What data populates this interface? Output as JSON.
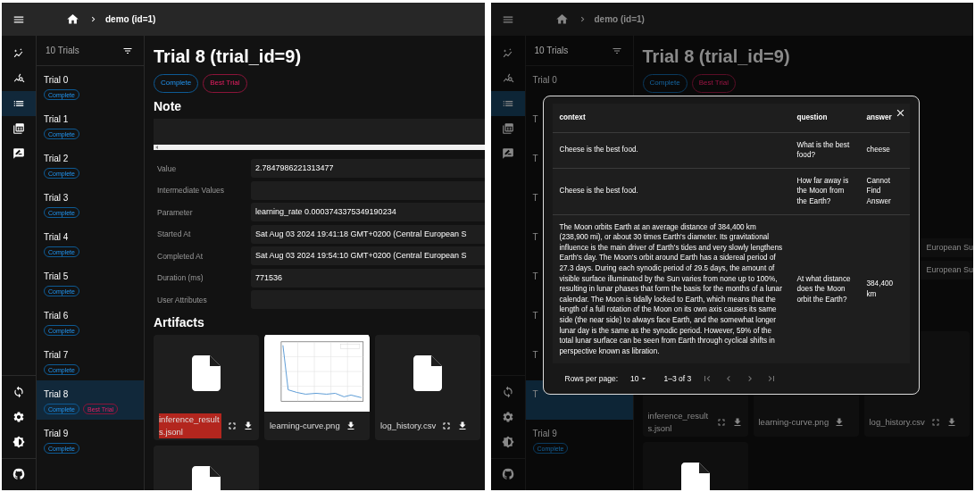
{
  "panels": [
    {
      "header": {
        "breadcrumb": "demo (id=1)"
      },
      "rail": [
        {
          "kind": "sparkle-chart",
          "selected": false
        },
        {
          "kind": "search-chart",
          "selected": false
        },
        {
          "kind": "list",
          "selected": true
        },
        {
          "kind": "table",
          "selected": false
        },
        {
          "kind": "feedback",
          "selected": false
        },
        {
          "kind": "sync",
          "selected": false
        },
        {
          "kind": "settings",
          "selected": false
        },
        {
          "kind": "theme",
          "selected": false
        },
        {
          "kind": "repo",
          "selected": false
        }
      ],
      "trial_list": {
        "count": "10 Trials",
        "trials": [
          {
            "name": "Trial 0",
            "selected": false,
            "badges": [
              {
                "label": "Complete",
                "kind": "complete"
              }
            ]
          },
          {
            "name": "Trial 1",
            "selected": false,
            "badges": [
              {
                "label": "Complete",
                "kind": "complete"
              }
            ]
          },
          {
            "name": "Trial 2",
            "selected": false,
            "badges": [
              {
                "label": "Complete",
                "kind": "complete"
              }
            ]
          },
          {
            "name": "Trial 3",
            "selected": false,
            "badges": [
              {
                "label": "Complete",
                "kind": "complete"
              }
            ]
          },
          {
            "name": "Trial 4",
            "selected": false,
            "badges": [
              {
                "label": "Complete",
                "kind": "complete"
              }
            ]
          },
          {
            "name": "Trial 5",
            "selected": false,
            "badges": [
              {
                "label": "Complete",
                "kind": "complete"
              }
            ]
          },
          {
            "name": "Trial 6",
            "selected": false,
            "badges": [
              {
                "label": "Complete",
                "kind": "complete"
              }
            ]
          },
          {
            "name": "Trial 7",
            "selected": false,
            "badges": [
              {
                "label": "Complete",
                "kind": "complete"
              }
            ]
          },
          {
            "name": "Trial 8",
            "selected": true,
            "badges": [
              {
                "label": "Complete",
                "kind": "complete"
              },
              {
                "label": "Best Trial",
                "kind": "best"
              }
            ]
          },
          {
            "name": "Trial 9",
            "selected": false,
            "badges": [
              {
                "label": "Complete",
                "kind": "complete"
              }
            ]
          }
        ]
      },
      "detail": {
        "title": "Trial 8 (trial_id=9)",
        "badges": [
          {
            "label": "Complete",
            "kind": "complete"
          },
          {
            "label": "Best Trial",
            "kind": "best"
          }
        ],
        "note_heading": "Note",
        "fields": [
          {
            "label": "Value",
            "value": "2.7847986221313477"
          },
          {
            "label": "Intermediate Values"
          },
          {
            "label": "Parameter",
            "value": "learning_rate 0.0003743375349190234"
          },
          {
            "label": "Started At",
            "value": "Sat Aug 03 2024 19:41:18 GMT+0200 (Central European S"
          },
          {
            "label": "Completed At",
            "value": "Sat Aug 03 2024 19:54:10 GMT+0200 (Central European S"
          },
          {
            "label": "Duration (ms)",
            "value": "771536"
          },
          {
            "label": "User Attributes"
          }
        ],
        "artifacts_heading": "Artifacts",
        "artifacts": [
          {
            "kind": "file",
            "name": "inference_results.jsonl",
            "highlighted": true,
            "fullscreen": true
          },
          {
            "kind": "image",
            "name": "learning-curve.png",
            "highlighted": false,
            "fullscreen": false
          },
          {
            "kind": "file",
            "name": "log_history.csv",
            "highlighted": false,
            "fullscreen": true
          },
          {
            "kind": "file"
          }
        ]
      }
    },
    {
      "header": {
        "breadcrumb": "demo (id=1)"
      },
      "rail": [
        {
          "kind": "sparkle-chart",
          "selected": false
        },
        {
          "kind": "search-chart",
          "selected": false
        },
        {
          "kind": "list",
          "selected": true
        },
        {
          "kind": "table",
          "selected": false
        },
        {
          "kind": "feedback",
          "selected": false
        },
        {
          "kind": "sync",
          "selected": false
        },
        {
          "kind": "settings",
          "selected": false
        },
        {
          "kind": "theme",
          "selected": false
        },
        {
          "kind": "repo",
          "selected": false
        }
      ],
      "trial_list": {
        "count": "10 Trials",
        "trials": [
          {
            "name": "Trial 0",
            "selected": false
          },
          {
            "name": "T",
            "selected": false
          },
          {
            "name": "T",
            "selected": false
          },
          {
            "name": "T",
            "selected": false
          },
          {
            "name": "T",
            "selected": false
          },
          {
            "name": "T",
            "selected": false
          },
          {
            "name": "T",
            "selected": false
          },
          {
            "name": "T",
            "selected": false
          },
          {
            "name": "T",
            "selected": true
          },
          {
            "name": "Trial 9",
            "selected": false,
            "badges": [
              {
                "label": "Complete",
                "kind": "complete"
              }
            ]
          }
        ]
      },
      "detail": {
        "title": "Trial 8 (trial_id=9)",
        "badges": [
          {
            "label": "Complete",
            "kind": "complete"
          },
          {
            "label": "Best Trial",
            "kind": "best"
          }
        ],
        "fields": [
          {
            "value": "European Su"
          },
          {
            "value": "European Su"
          }
        ],
        "artifacts": [
          {
            "kind": "file",
            "name": "inference_results.jsonl",
            "highlighted": false,
            "fullscreen": true
          },
          {
            "kind": "image",
            "name": "learning-curve.png",
            "highlighted": false,
            "fullscreen": false
          },
          {
            "kind": "file",
            "name": "log_history.csv",
            "highlighted": false,
            "fullscreen": true
          },
          {
            "kind": "file"
          }
        ]
      },
      "modal": {
        "columns": [
          "context",
          "question",
          "answer"
        ],
        "rows": [
          {
            "context": "Cheese is the best food.",
            "question": "What is the best food?",
            "answer": "cheese"
          },
          {
            "context": "Cheese is the best food.",
            "question": "How far away is the Moon from the Earth?",
            "answer": "Cannot Find Answer"
          },
          {
            "context": "The Moon orbits Earth at an average distance of 384,400 km (238,900 mi), or about 30 times Earth's diameter. Its gravitational influence is the main driver of Earth's tides and very slowly lengthens Earth's day. The Moon's orbit around Earth has a sidereal period of 27.3 days. During each synodic period of 29.5 days, the amount of visible surface illuminated by the Sun varies from none up to 100%, resulting in lunar phases that form the basis for the months of a lunar calendar. The Moon is tidally locked to Earth, which means that the length of a full rotation of the Moon on its own axis causes its same side (the near side) to always face Earth, and the somewhat longer lunar day is the same as the synodic period. However, 59% of the total lunar surface can be seen from Earth through cyclical shifts in perspective known as libration.",
            "question": "At what distance does the Moon orbit the Earth?",
            "answer": "384,400 km"
          }
        ],
        "footer": {
          "rows_per_page_label": "Rows per page:",
          "rows_per_page": "10",
          "range": "1–3 of 3"
        }
      }
    }
  ]
}
